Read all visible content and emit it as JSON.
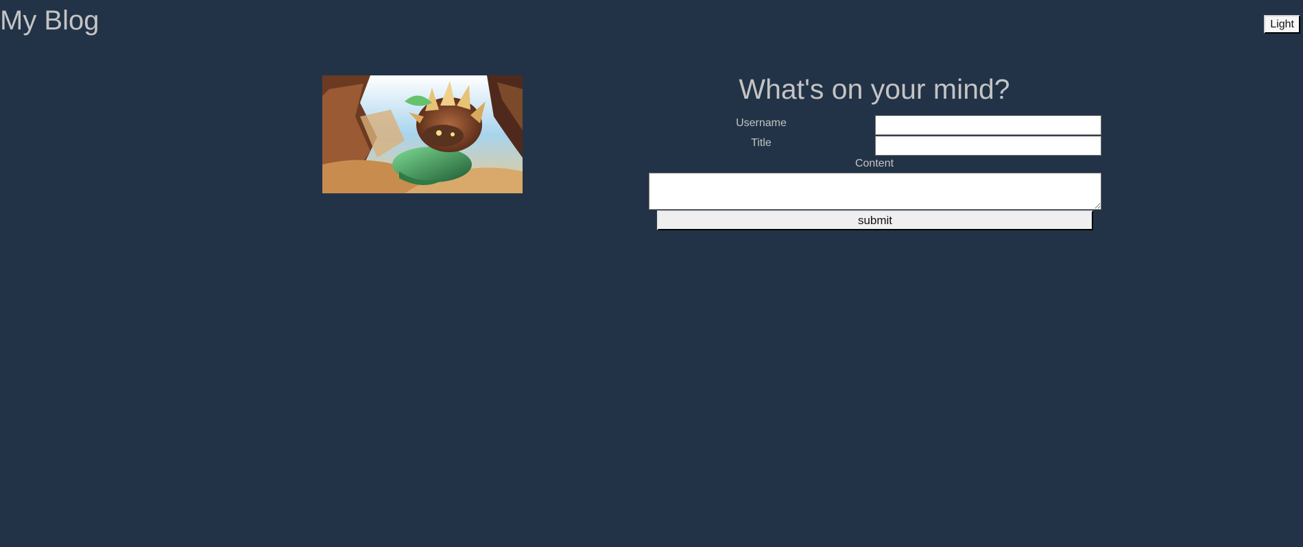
{
  "header": {
    "site_title": "My Blog",
    "theme_toggle_label": "Light"
  },
  "form": {
    "heading": "What's on your mind?",
    "username_label": "Username",
    "username_value": "",
    "title_label": "Title",
    "title_value": "",
    "content_label": "Content",
    "content_value": "",
    "submit_label": "submit"
  },
  "colors": {
    "background": "#233347",
    "text": "#c4c4c4"
  },
  "image": {
    "subject": "game-character-illustration"
  }
}
